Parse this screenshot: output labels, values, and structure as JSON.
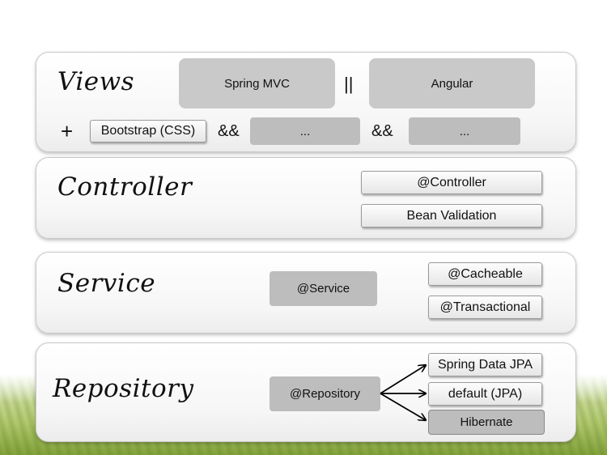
{
  "views": {
    "title": "Views",
    "spring_mvc": "Spring MVC",
    "or_op": "||",
    "angular": "Angular",
    "plus": "+",
    "bootstrap": "Bootstrap (CSS)",
    "and_op_1": "&&",
    "ellipsis_1": "...",
    "and_op_2": "&&",
    "ellipsis_2": "..."
  },
  "controller": {
    "title": "Controller",
    "annotation": "@Controller",
    "validation": "Bean Validation"
  },
  "service": {
    "title": "Service",
    "annotation": "@Service",
    "cacheable": "@Cacheable",
    "transactional": "@Transactional"
  },
  "repository": {
    "title": "Repository",
    "annotation": "@Repository",
    "targets": [
      "Spring Data JPA",
      "default (JPA)",
      "Hibernate"
    ]
  }
}
